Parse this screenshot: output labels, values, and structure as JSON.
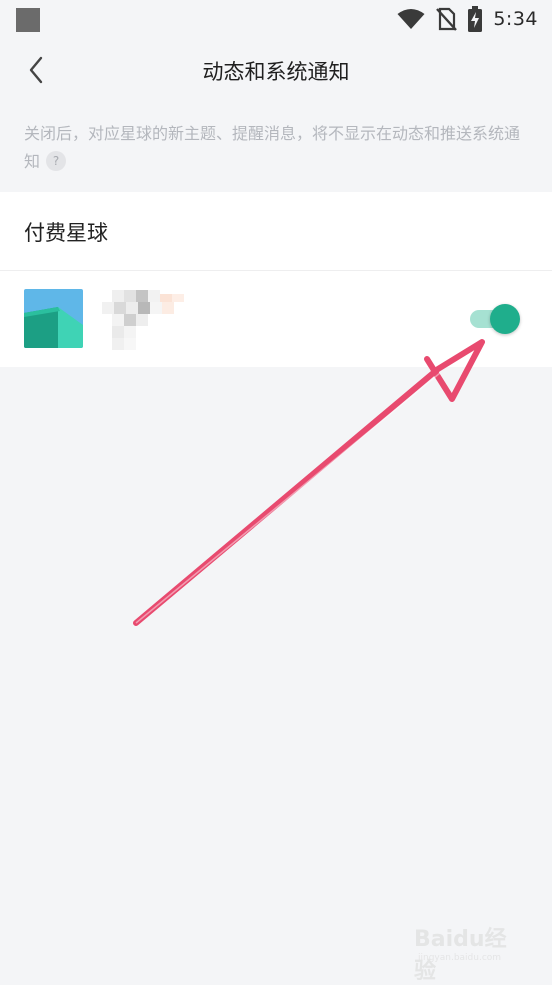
{
  "status_bar": {
    "time": "5:34",
    "icons": [
      "wifi-icon",
      "no-sim-icon",
      "battery-charging-icon"
    ]
  },
  "header": {
    "title": "动态和系统通知",
    "back_icon": "chevron-left-icon"
  },
  "description": {
    "text": "关闭后，对应星球的新主题、提醒消息，将不显示在动态和推送系统通知",
    "help_icon_label": "?"
  },
  "section": {
    "title": "付费星球",
    "items": [
      {
        "avatar_icon": "planet-avatar-image",
        "toggle_on": true
      }
    ]
  },
  "colors": {
    "toggle_thumb": "#1fae8c",
    "toggle_track": "#a6e1d2",
    "arrow": "#e84a6f",
    "background": "#f4f5f7"
  },
  "watermark": {
    "brand": "Baidu经验",
    "url": "jingyan.baidu.com"
  }
}
